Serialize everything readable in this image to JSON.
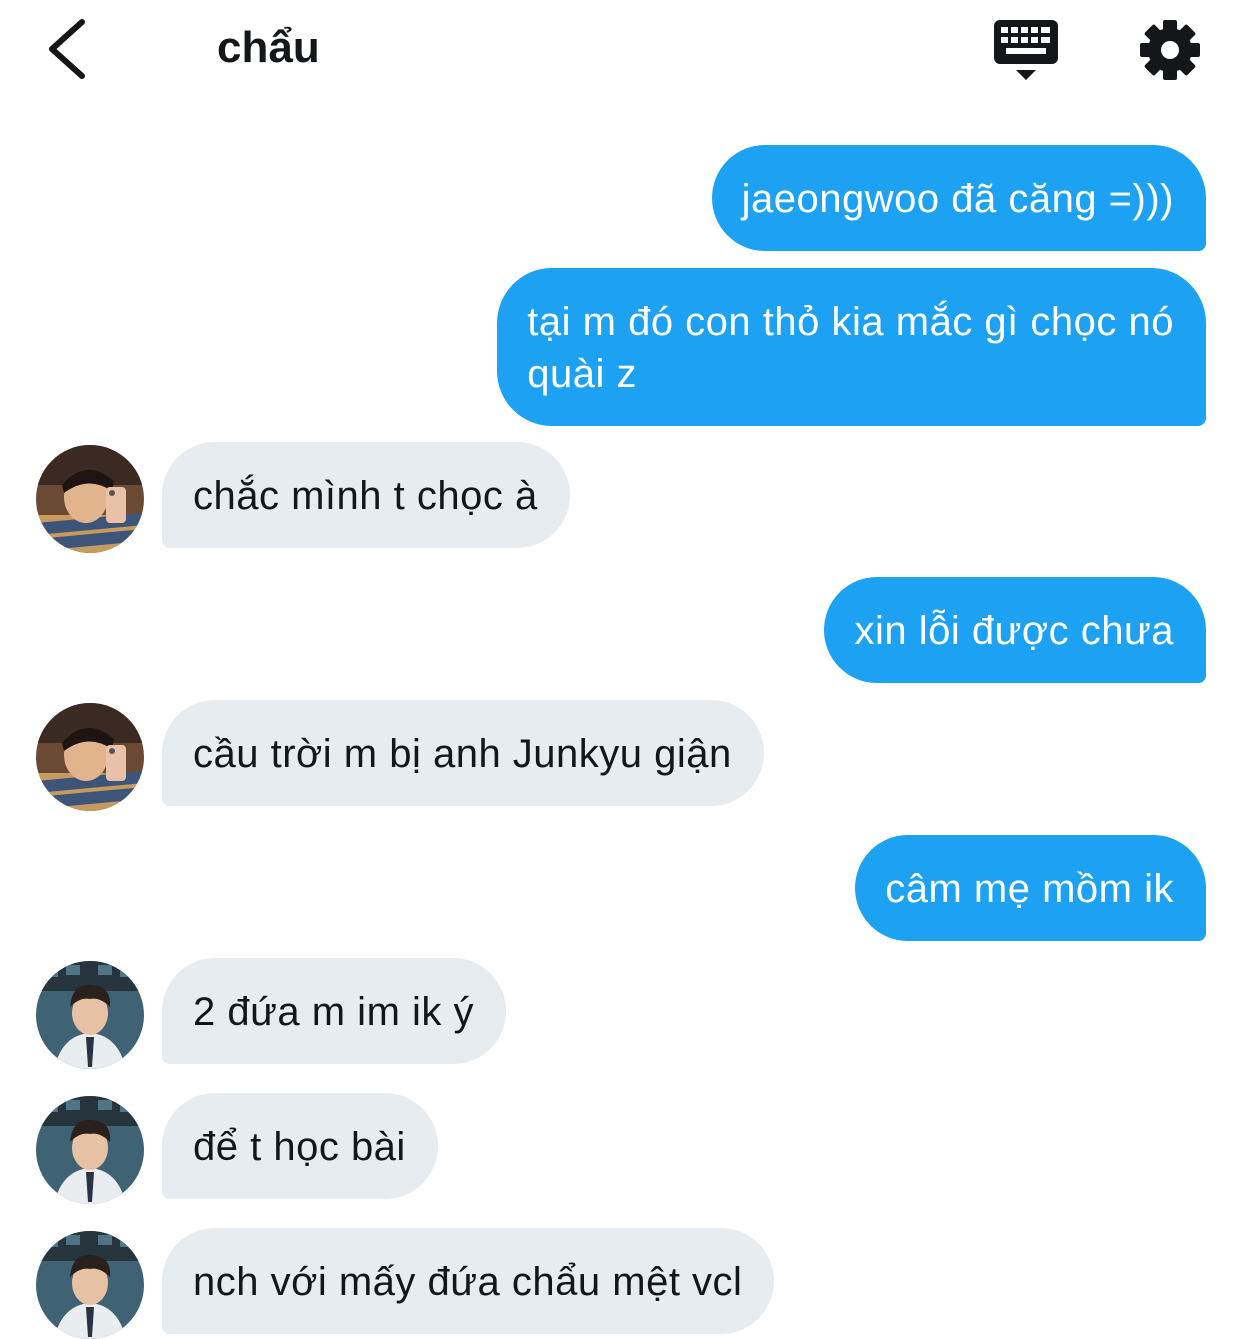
{
  "header": {
    "title": "chẩu",
    "back_icon": "chevron-left-icon",
    "keyboard_icon": "keyboard-icon",
    "settings_icon": "gear-icon"
  },
  "colors": {
    "outgoing_bubble": "#1da1f2",
    "incoming_bubble": "#e6ecf0",
    "text_dark": "#14171a"
  },
  "messages": [
    {
      "direction": "outgoing",
      "text": "jaeongwoo đã căng =)))"
    },
    {
      "direction": "outgoing",
      "text": "tại m đó con thỏ kia mắc gì chọc nó\nquài z"
    },
    {
      "direction": "incoming",
      "sender_avatar": "avatar-mirror-selfie",
      "text": "chắc mình t chọc à"
    },
    {
      "direction": "outgoing",
      "text": "xin lỗi được chưa"
    },
    {
      "direction": "incoming",
      "sender_avatar": "avatar-mirror-selfie",
      "text": "cầu trời m bị anh Junkyu giận"
    },
    {
      "direction": "outgoing",
      "text": "câm mẹ mồm ik"
    },
    {
      "direction": "incoming",
      "sender_avatar": "avatar-school-uniform",
      "text": "2 đứa m im ik ý"
    },
    {
      "direction": "incoming",
      "sender_avatar": "avatar-school-uniform",
      "text": "để t học bài"
    },
    {
      "direction": "incoming",
      "sender_avatar": "avatar-school-uniform",
      "text": "nch với mấy đứa chẩu mệt vcl"
    }
  ]
}
